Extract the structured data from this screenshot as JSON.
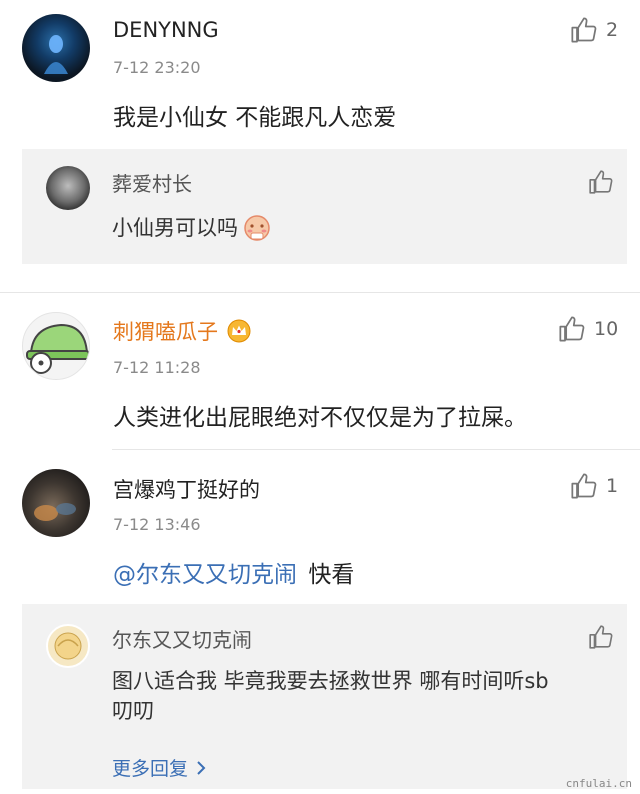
{
  "comments": [
    {
      "name": "DENYNNG",
      "time": "7-12 23:20",
      "text": "我是小仙女 不能跟凡人恋爱",
      "likes": "2",
      "reply": {
        "name": "葬爱村长",
        "text": "小仙男可以吗"
      }
    },
    {
      "name": "刺猬嗑瓜子",
      "time": "7-12 11:28",
      "text": "人类进化出屁眼绝对不仅仅是为了拉屎。",
      "likes": "10"
    },
    {
      "name": "宫爆鸡丁挺好的",
      "time": "7-12 13:46",
      "mention": "@尔东又又切克闹",
      "text": "快看",
      "likes": "1",
      "reply": {
        "name": "尔东又又切克闹",
        "text_line1": "图八适合我 毕竟我要去拯救世界 哪有时间听sb",
        "text_line2": "叨叨"
      },
      "more": "更多回复"
    }
  ],
  "watermark": "cnfulai.cn",
  "icons": {
    "like": "thumbs-up-icon",
    "vip": "crown-icon",
    "emoji": "shy-face-emoji-icon",
    "chevron": "chevron-right-icon"
  }
}
